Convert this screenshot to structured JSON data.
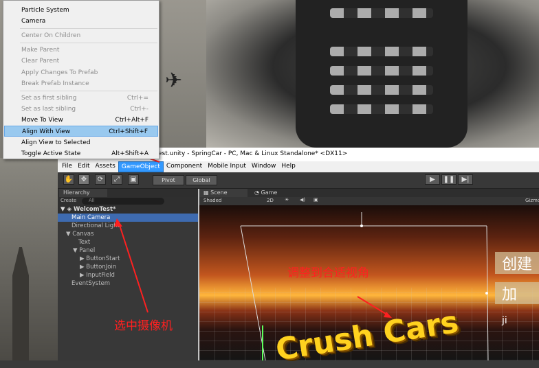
{
  "menu": {
    "items": [
      {
        "label": "",
        "shortcut": "",
        "disabled": false
      },
      {
        "label": "Particle System",
        "shortcut": "",
        "disabled": false
      },
      {
        "label": "Camera",
        "shortcut": "",
        "disabled": false
      },
      {
        "label": "Center On Children",
        "shortcut": "",
        "disabled": true
      },
      {
        "label": "Make Parent",
        "shortcut": "",
        "disabled": true
      },
      {
        "label": "Clear Parent",
        "shortcut": "",
        "disabled": true
      },
      {
        "label": "Apply Changes To Prefab",
        "shortcut": "",
        "disabled": true
      },
      {
        "label": "Break Prefab Instance",
        "shortcut": "",
        "disabled": true
      },
      {
        "label": "Set as first sibling",
        "shortcut": "Ctrl+=",
        "disabled": true
      },
      {
        "label": "Set as last sibling",
        "shortcut": "Ctrl+-",
        "disabled": true
      },
      {
        "label": "Move To View",
        "shortcut": "Ctrl+Alt+F",
        "disabled": false
      },
      {
        "label": "Align With View",
        "shortcut": "Ctrl+Shift+F",
        "disabled": false,
        "highlighted": true
      },
      {
        "label": "Align View to Selected",
        "shortcut": "",
        "disabled": false
      },
      {
        "label": "Toggle Active State",
        "shortcut": "Alt+Shift+A",
        "disabled": false
      }
    ]
  },
  "window": {
    "title": "est.unity - SpringCar - PC, Mac & Linux Standalone* <DX11>"
  },
  "menubar": [
    "File",
    "Edit",
    "Assets",
    "GameObject",
    "Component",
    "Mobile Input",
    "Window",
    "Help"
  ],
  "toolbar": {
    "pivot": "Pivot",
    "global": "Global"
  },
  "hierarchy": {
    "tab": "Hierarchy",
    "create": "Create",
    "search_placeholder": "All",
    "scene": "WelcomTest*",
    "rows": [
      "Main Camera",
      "Directional Light",
      "Canvas",
      "Text",
      "Panel",
      "ButtonStart",
      "ButtonJoin",
      "InputField",
      "EventSystem"
    ]
  },
  "scene": {
    "tab_scene": "Scene",
    "tab_game": "Game",
    "shading": "Shaded",
    "mode2d": "2D",
    "gizmos": "Gizmo",
    "title_text": "Crush Cars",
    "side1": "创建",
    "side2": "加",
    "side3": "ji"
  },
  "annotations": {
    "adjust": "调整到合适视角",
    "select": "选中摄像机"
  },
  "colors": {
    "highlight": "#99c9ef",
    "selection": "#3e6bb0",
    "annotation": "#ff2020",
    "active_menu": "#3399ff"
  }
}
